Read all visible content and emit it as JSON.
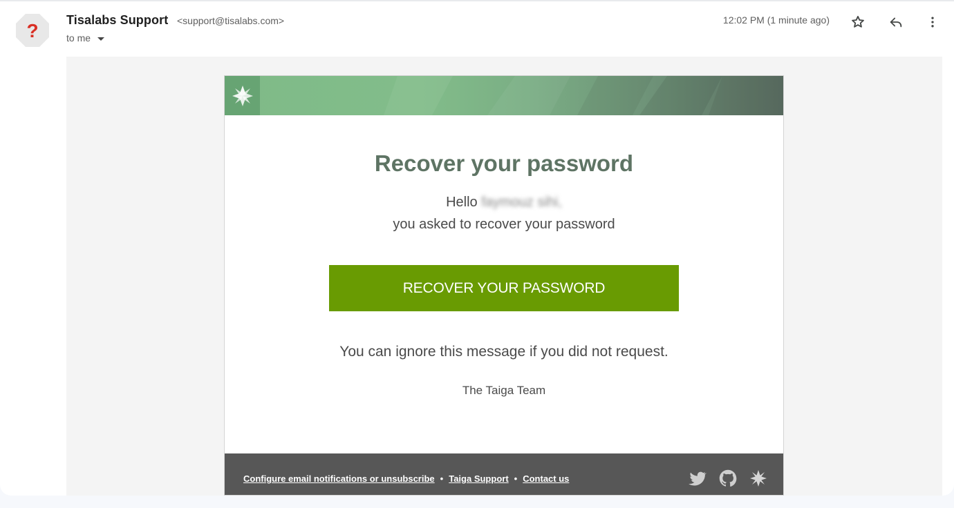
{
  "header": {
    "sender_name": "Tisalabs Support",
    "sender_email": "<support@tisalabs.com>",
    "recipient": "to me",
    "timestamp": "12:02 PM (1 minute ago)"
  },
  "icons": {
    "avatar": "unknown-sender-question-icon",
    "star": "star-icon",
    "reply": "reply-icon",
    "more": "more-vert-icon",
    "caret": "caret-down-icon",
    "banner_logo": "taiga-logo-icon",
    "twitter": "twitter-icon",
    "github": "github-icon",
    "taiga": "taiga-icon"
  },
  "email": {
    "title": "Recover your password",
    "hello_prefix": "Hello",
    "user_name_redacted": "faymouz sihi,",
    "asked_line": "you asked to recover your password",
    "button_label": "RECOVER YOUR PASSWORD",
    "ignore_text": "You can ignore this message if you did not request.",
    "signature": "The Taiga Team"
  },
  "footer": {
    "link_configure": "Configure email notifications or unsubscribe",
    "link_support": "Taiga Support",
    "link_contact": "Contact us",
    "separator": "•"
  },
  "colors": {
    "button": "#699b02",
    "title": "#5e7464",
    "footer": "#575757",
    "banner_start": "#7fba88",
    "banner_end": "#5c6f63"
  }
}
